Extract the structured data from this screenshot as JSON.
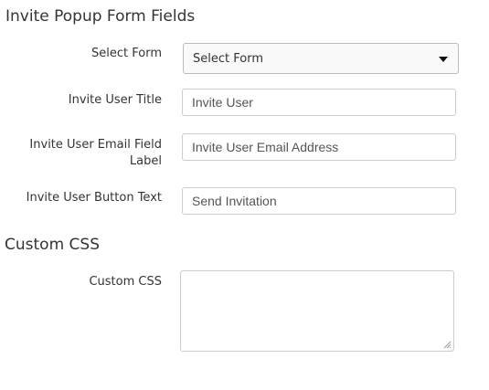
{
  "invite_section": {
    "title": "Invite Popup Form Fields",
    "select_form": {
      "label": "Select Form",
      "value": "Select Form"
    },
    "invite_user_title": {
      "label": "Invite User Title",
      "value": "Invite User"
    },
    "invite_user_email_label": {
      "label": "Invite User Email Field Label",
      "value": "Invite User Email Address"
    },
    "invite_user_button_text": {
      "label": "Invite User Button Text",
      "value": "Send Invitation"
    }
  },
  "css_section": {
    "title": "Custom CSS",
    "custom_css": {
      "label": "Custom CSS",
      "value": ""
    }
  },
  "icons": {
    "select_caret": "caret-down-icon",
    "textarea_resize": "resize-handle-icon"
  },
  "colors": {
    "text": "#333333",
    "input_border": "#cccccc",
    "select_background": "#f9f9f9"
  }
}
